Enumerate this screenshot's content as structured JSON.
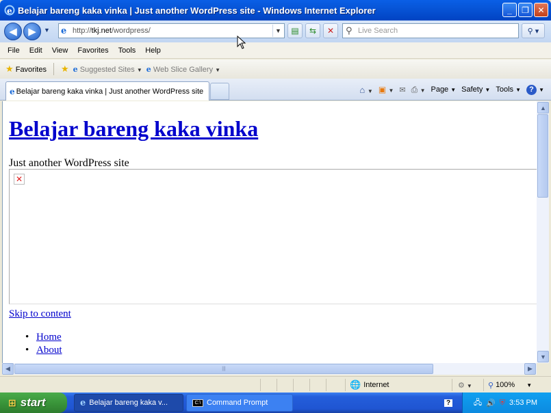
{
  "window": {
    "title": "Belajar bareng kaka vinka | Just another WordPress site - Windows Internet Explorer",
    "buttons": [
      "minimize",
      "restore",
      "close"
    ]
  },
  "address_bar": {
    "url_prefix": "http://",
    "url_domain": "tkj.net",
    "url_path": "/wordpress/",
    "search_placeholder": "Live Search"
  },
  "menu": {
    "items": [
      "File",
      "Edit",
      "View",
      "Favorites",
      "Tools",
      "Help"
    ]
  },
  "favorites_bar": {
    "favorites_label": "Favorites",
    "suggested_sites": "Suggested Sites",
    "web_slice_gallery": "Web Slice Gallery"
  },
  "tabs": {
    "active_tab": "Belajar bareng kaka vinka | Just another WordPress site"
  },
  "command_bar": {
    "page": "Page",
    "safety": "Safety",
    "tools": "Tools"
  },
  "page": {
    "site_title": "Belajar bareng kaka vinka",
    "tagline": "Just another WordPress site",
    "skip_link": "Skip to content",
    "nav": [
      "Home",
      "About"
    ]
  },
  "status_bar": {
    "zone": "Internet",
    "zoom": "100%"
  },
  "taskbar": {
    "start": "start",
    "tasks": [
      "Belajar bareng kaka v...",
      "Command Prompt"
    ],
    "clock": "3:53 PM"
  },
  "colors": {
    "titlebar": "#0755d7",
    "link": "#0000cc",
    "start_button": "#3a953a",
    "taskbar": "#245edb"
  }
}
